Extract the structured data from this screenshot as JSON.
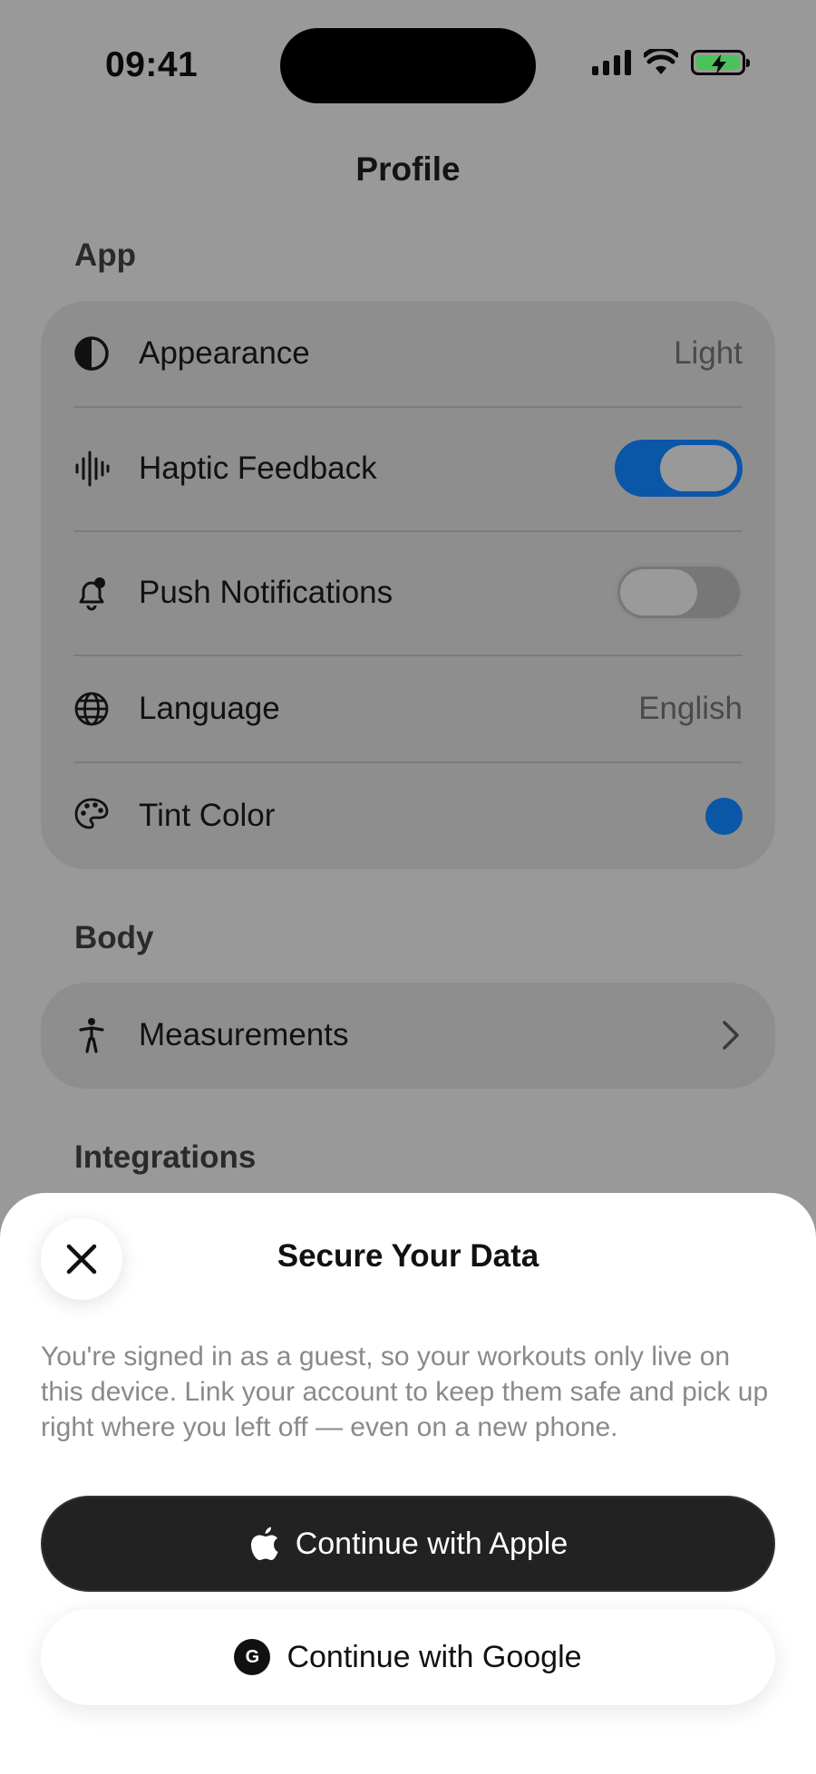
{
  "status_bar": {
    "time": "09:41"
  },
  "header": {
    "title": "Profile"
  },
  "sections": {
    "app": {
      "label": "App",
      "rows": {
        "appearance": {
          "label": "Appearance",
          "value": "Light",
          "icon": "half-circle-icon"
        },
        "haptic": {
          "label": "Haptic Feedback",
          "enabled": true,
          "icon": "waveform-icon"
        },
        "push": {
          "label": "Push Notifications",
          "enabled": false,
          "icon": "bell-badge-icon"
        },
        "language": {
          "label": "Language",
          "value": "English",
          "icon": "globe-icon"
        },
        "tint": {
          "label": "Tint Color",
          "color": "#0a57a8",
          "icon": "palette-icon"
        }
      }
    },
    "body": {
      "label": "Body",
      "rows": {
        "measurements": {
          "label": "Measurements",
          "icon": "person-icon"
        }
      }
    },
    "integrations": {
      "label": "Integrations"
    }
  },
  "sheet": {
    "title": "Secure Your Data",
    "body": "You're signed in as a guest, so your workouts only live on this device. Link your account to keep them safe and pick up right where you left off — even on a new phone.",
    "apple_button": "Continue with Apple",
    "google_button": "Continue with Google",
    "google_badge": "G"
  },
  "colors": {
    "accent": "#0a57a8",
    "battery": "#4cc35a",
    "dim_overlay": "#999999"
  }
}
